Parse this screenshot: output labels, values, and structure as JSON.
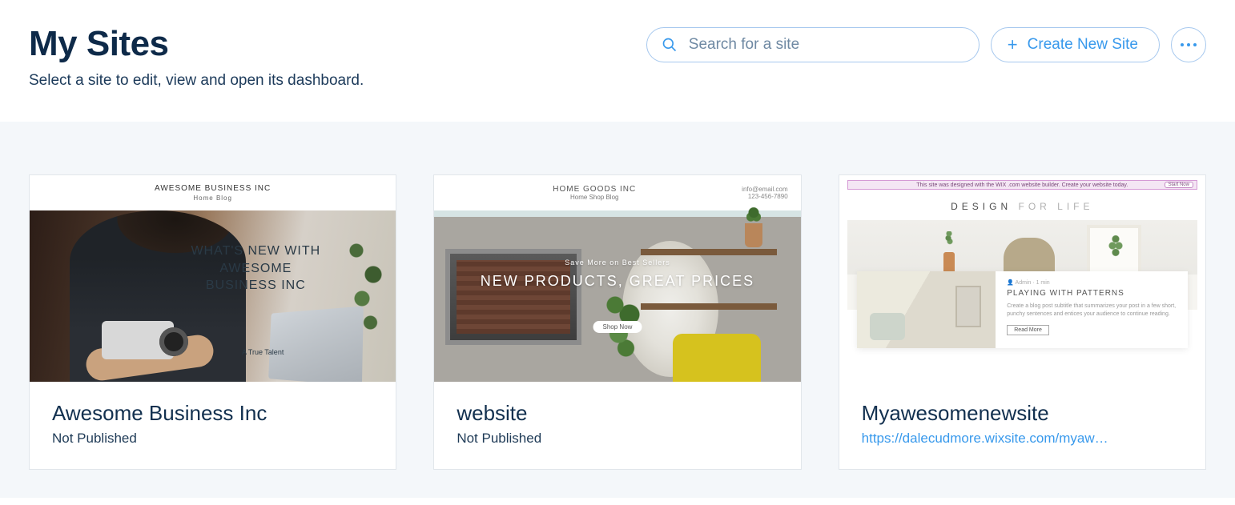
{
  "header": {
    "title": "My Sites",
    "subtitle": "Select a site to edit, view and open its dashboard."
  },
  "search": {
    "placeholder": "Search for a site",
    "value": ""
  },
  "actions": {
    "create_label": "Create New Site"
  },
  "sites": [
    {
      "name": "Awesome Business Inc",
      "status": "Not Published",
      "url": null,
      "preview": {
        "brand": "AWESOME BUSINESS INC",
        "nav": "Home   Blog",
        "hero_text": "WHAT'S NEW WITH AWESOME BUSINESS INC",
        "hero_sub": "A True Talent"
      }
    },
    {
      "name": "website",
      "status": "Not Published",
      "url": null,
      "preview": {
        "brand": "HOME GOODS INC",
        "nav": "Home   Shop   Blog",
        "contact": "info@email.com\n123-456-7890",
        "hero_small": "Save More on Best Sellers",
        "hero_text": "NEW PRODUCTS, GREAT PRICES",
        "cta": "Shop Now"
      }
    },
    {
      "name": "Myawesomenewsite",
      "status": null,
      "url": "https://dalecudmore.wixsite.com/myaw…",
      "preview": {
        "banner": "This site was designed with the WIX .com website builder. Create your website today.",
        "banner_btn": "Start Now",
        "brand_a": "DESIGN",
        "brand_b": "FOR LIFE",
        "inset_heading": "PLAYING WITH PATTERNS",
        "inset_text": "Create a blog post subtitle that summarizes your post in a few short, punchy sentences and entices your audience to continue reading.",
        "inset_btn": "Read More"
      }
    }
  ]
}
